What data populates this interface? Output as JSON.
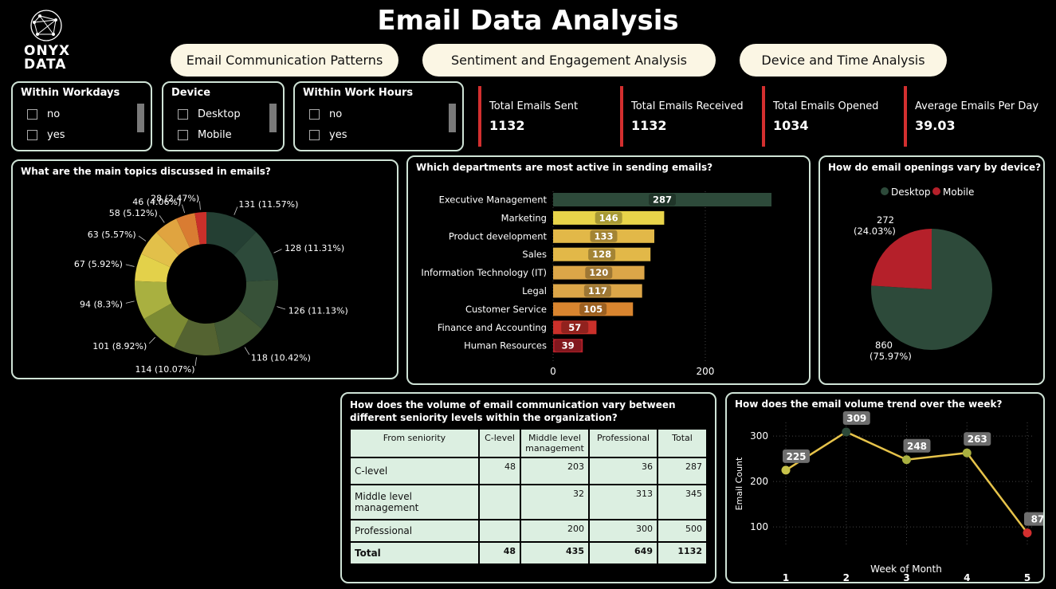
{
  "brand": {
    "line1": "ONYX",
    "line2": "DATA"
  },
  "title": "Email Data Analysis",
  "tabs": [
    "Email Communication Patterns",
    "Sentiment and Engagement Analysis",
    "Device and Time Analysis"
  ],
  "slicers": {
    "workdays": {
      "title": "Within Workdays",
      "options": [
        "no",
        "yes"
      ]
    },
    "device": {
      "title": "Device",
      "options": [
        "Desktop",
        "Mobile"
      ]
    },
    "workhours": {
      "title": "Within Work Hours",
      "options": [
        "no",
        "yes"
      ]
    }
  },
  "kpis": [
    {
      "label": "Total Emails Sent",
      "value": "1132"
    },
    {
      "label": "Total Emails Received",
      "value": "1132"
    },
    {
      "label": "Total Emails Opened",
      "value": "1034"
    },
    {
      "label": "Average Emails Per Day",
      "value": "39.03"
    }
  ],
  "colors": {
    "accent": "#d32f2f",
    "desktop": "#2d4a3a",
    "mobile": "#b5202a",
    "panel_border": "#cfe3d6",
    "table_bg": "#dcefe1",
    "line": "#e6c34a"
  },
  "chart_data": [
    {
      "type": "pie",
      "variant": "donut",
      "title": "What are the main topics discussed in emails?",
      "values": [
        131,
        128,
        126,
        118,
        114,
        101,
        94,
        67,
        63,
        58,
        46,
        28
      ],
      "labels": [
        "131 (11.57%)",
        "128 (11.31%)",
        "126 (11.13%)",
        "118 (10.42%)",
        "114 (10.07%)",
        "101 (8.92%)",
        "94 (8.3%)",
        "67 (5.92%)",
        "63 (5.57%)",
        "58 (5.12%)",
        "46 (4.06%)",
        "28 (2.47%)"
      ],
      "colors": [
        "#243f33",
        "#2d4a3a",
        "#375138",
        "#435a35",
        "#546331",
        "#7c8b33",
        "#a9b040",
        "#e3d14a",
        "#e2c04a",
        "#e0a440",
        "#d97c32",
        "#c9302a"
      ]
    },
    {
      "type": "bar",
      "orientation": "horizontal",
      "title": "Which departments are most active in sending emails?",
      "categories": [
        "Executive Management",
        "Marketing",
        "Product development",
        "Sales",
        "Information Technology (IT)",
        "Legal",
        "Customer Service",
        "Finance and Accounting",
        "Human Resources"
      ],
      "values": [
        287,
        146,
        133,
        128,
        120,
        117,
        105,
        57,
        39
      ],
      "colors": [
        "#2d4a3a",
        "#e8d44a",
        "#e2b848",
        "#e2b848",
        "#dca648",
        "#dca648",
        "#d9852f",
        "#c9302a",
        "#b5202a"
      ],
      "xlim": [
        0,
        287
      ],
      "xticks": [
        0,
        200
      ]
    },
    {
      "type": "pie",
      "title": "How do email openings vary by device?",
      "categories": [
        "Desktop",
        "Mobile"
      ],
      "values": [
        860,
        272
      ],
      "labels": [
        "860 (75.97%)",
        "272 (24.03%)"
      ],
      "legend": "top"
    },
    {
      "type": "table",
      "title": "How does the volume of email communication vary between different seniority levels within the organization?",
      "columns": [
        "From seniority",
        "C-level",
        "Middle level management",
        "Professional",
        "Total"
      ],
      "rows": [
        [
          "C-level",
          "48",
          "203",
          "36",
          "287"
        ],
        [
          "Middle level management",
          "",
          "32",
          "313",
          "345"
        ],
        [
          "Professional",
          "",
          "200",
          "300",
          "500"
        ],
        [
          "Total",
          "48",
          "435",
          "649",
          "1132"
        ]
      ]
    },
    {
      "type": "line",
      "title": "How does the email volume trend over the week?",
      "x": [
        1,
        2,
        3,
        4,
        5
      ],
      "y": [
        225,
        309,
        248,
        263,
        87
      ],
      "xlabel": "Week of Month",
      "ylabel": "Email Count",
      "yticks": [
        100,
        200,
        300
      ],
      "ylim": [
        60,
        330
      ],
      "grid": true
    }
  ]
}
